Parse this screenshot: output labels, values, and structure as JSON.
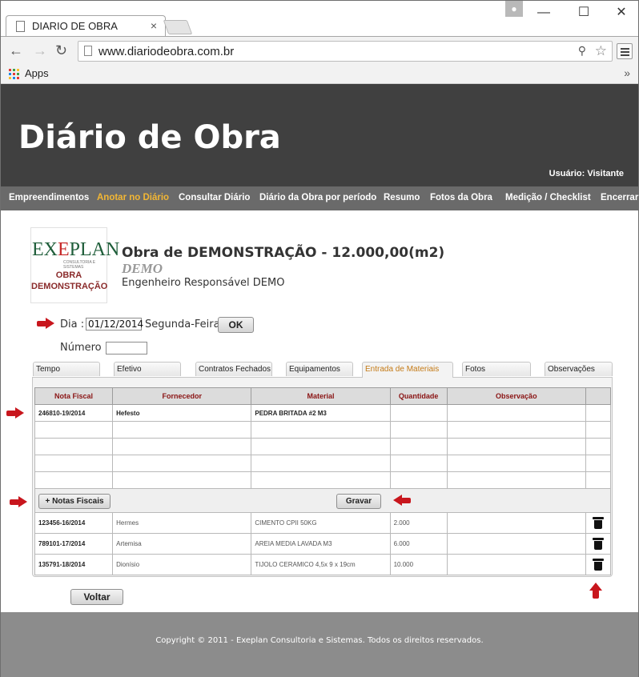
{
  "browser": {
    "tab_title": "DIARIO DE OBRA",
    "url": "www.diariodeobra.com.br",
    "bookmarks_apps": "Apps"
  },
  "header": {
    "title": "Diário de Obra",
    "user": "Usuário: Visitante"
  },
  "nav": {
    "items": [
      "Empreendimentos",
      "Anotar no Diário",
      "Consultar Diário",
      "Diário da Obra por período",
      "Resumo",
      "Fotos da Obra",
      "Medição / Checklist",
      "Encerrar"
    ],
    "active_index": 1,
    "active_color": "#f2b634"
  },
  "logo": {
    "brand": "EXEPLAN",
    "subtitle": "CONSULTORIA E SISTEMAS",
    "caption_line1": "OBRA",
    "caption_line2": "DEMONSTRAÇÃO"
  },
  "obra": {
    "title": "Obra de DEMONSTRAÇÃO - 12.000,00(m2)",
    "code": "DEMO",
    "engineer": "Engenheiro Responsável DEMO"
  },
  "form": {
    "dia_label": "Dia :",
    "dia_value": "01/12/2014",
    "weekday": "Segunda-Feira",
    "ok_label": "OK",
    "numero_label": "Número :",
    "numero_value": ""
  },
  "tabs": {
    "items": [
      "Tempo",
      "Efetivo",
      "Contratos Fechados",
      "Equipamentos",
      "Entrada de Materiais",
      "Fotos",
      "Observações"
    ],
    "active_index": 4
  },
  "grid": {
    "headers": [
      "Nota Fiscal",
      "Fornecedor",
      "Material",
      "Quantidade",
      "Observação"
    ],
    "entry_row": [
      "246810-19/2014",
      "Hefesto",
      "PEDRA BRITADA #2  M3",
      "",
      ""
    ],
    "notas_button": "+ Notas Fiscais",
    "gravar_button": "Gravar",
    "records": [
      [
        "123456-16/2014",
        "Hermes",
        "CIMENTO CPII 50KG",
        "2.000",
        ""
      ],
      [
        "789101-17/2014",
        "Artemisa",
        "AREIA MEDIA LAVADA M3",
        "6.000",
        ""
      ],
      [
        "135791-18/2014",
        "Dionísio",
        "TIJOLO CERAMICO 4,5x 9 x 19cm",
        "10.000",
        ""
      ]
    ]
  },
  "voltar_label": "Voltar",
  "footer": {
    "copyright": "Copyright © 2011 - Exeplan Consultoria e Sistemas. Todos os direitos reservados."
  },
  "colors": {
    "header_bg": "#404040",
    "nav_bg": "#6a6a6a",
    "footer_bg": "#8c8c8c",
    "annotation_arrow": "#c8161d",
    "grid_header_text": "#8a1414"
  }
}
